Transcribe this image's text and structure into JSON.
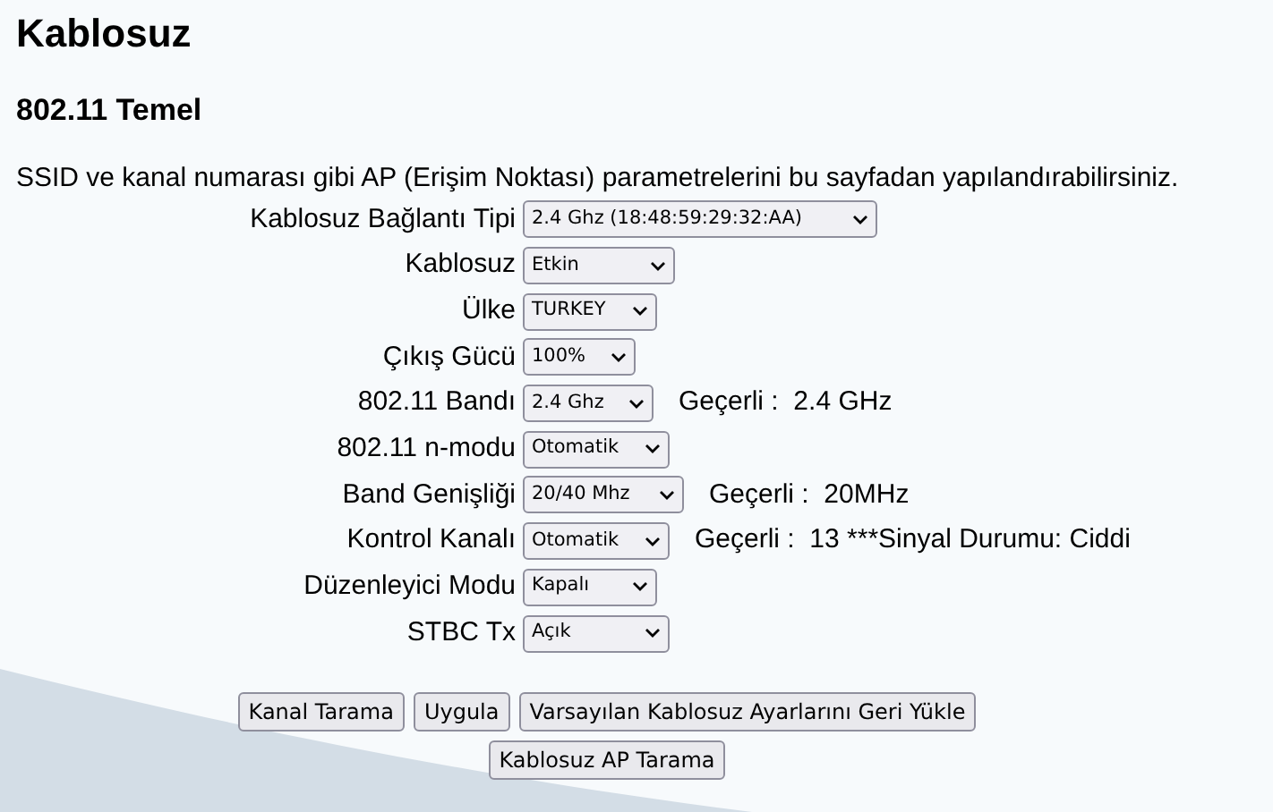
{
  "title": "Kablosuz",
  "subtitle": "802.11 Temel",
  "description": "SSID ve kanal numarası gibi AP (Erişim Noktası) parametrelerini bu sayfadan yapılandırabilirsiniz.",
  "settings": [
    {
      "label": "Kablosuz Bağlantı Tipi",
      "value": "2.4 Ghz (18:48:59:29:32:AA)"
    },
    {
      "label": "Kablosuz",
      "value": "Etkin"
    },
    {
      "label": "Ülke",
      "value": "TURKEY"
    },
    {
      "label": "Çıkış Gücü",
      "value": "100%"
    },
    {
      "label": "802.11 Bandı",
      "value": "2.4 Ghz",
      "status": "Geçerli :  2.4 GHz"
    },
    {
      "label": "802.11 n-modu",
      "value": "Otomatik"
    },
    {
      "label": "Band Genişliği",
      "value": "20/40 Mhz",
      "status": "Geçerli :  20MHz"
    },
    {
      "label": "Kontrol Kanalı",
      "value": "Otomatik",
      "status": "Geçerli :  13 ***Sinyal Durumu: Ciddi"
    },
    {
      "label": "Düzenleyici Modu",
      "value": "Kapalı"
    },
    {
      "label": "STBC Tx",
      "value": "Açık"
    }
  ],
  "buttons": [
    [
      "Kanal Tarama",
      "Uygula",
      "Varsayılan Kablosuz Ayarlarını Geri Yükle"
    ],
    [
      "Kablosuz AP Tarama"
    ]
  ]
}
